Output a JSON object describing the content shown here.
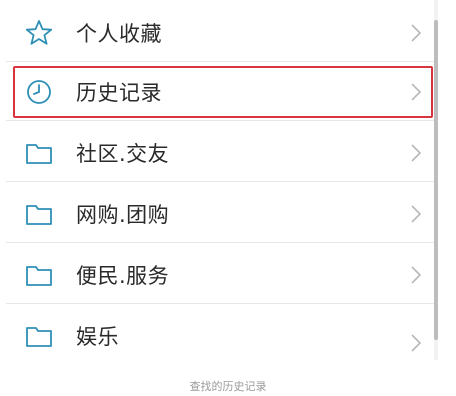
{
  "menu": {
    "items": [
      {
        "label": "个人收藏",
        "icon": "star-icon"
      },
      {
        "label": "历史记录",
        "icon": "clock-icon",
        "highlighted": true
      },
      {
        "label": "社区.交友",
        "icon": "folder-icon"
      },
      {
        "label": "网购.团购",
        "icon": "folder-icon"
      },
      {
        "label": "便民.服务",
        "icon": "folder-icon"
      },
      {
        "label": "娱乐",
        "icon": "folder-icon"
      }
    ]
  },
  "caption": "查找的历史记录",
  "colors": {
    "icon_accent": "#2e8fb6",
    "highlight_border": "#d8353f",
    "chevron": "#b8b8b8"
  }
}
